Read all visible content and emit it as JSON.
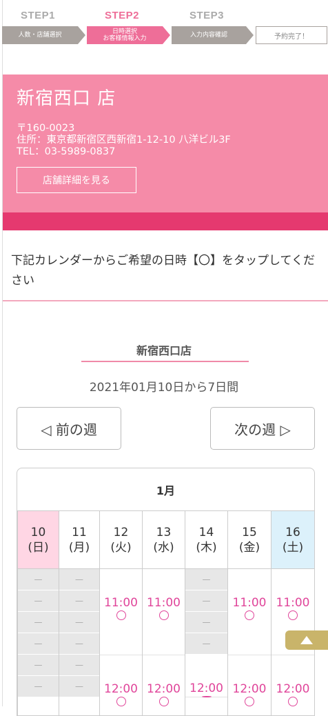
{
  "steps": [
    {
      "title": "STEP1",
      "label": "人数・店舗選択"
    },
    {
      "title": "STEP2",
      "label_line1": "日時選択",
      "label_line2": "お客様情報入力"
    },
    {
      "title": "STEP3",
      "label": "入力内容確認"
    },
    {
      "label": "予約完了！"
    }
  ],
  "store": {
    "name": "新宿西口 店",
    "address": "〒160-0023\n住所：東京都新宿区西新宿1-12-10 八洋ビル3F\nTEL：03-5989-0837",
    "detail_button": "店舗詳細を見る"
  },
  "instruction": "下記カレンダーからご希望の日時【〇】をタップしてください",
  "calendar": {
    "title": "新宿西口店",
    "range": "2021年01月10日から7日間",
    "prev_week": "◁ 前の週",
    "next_week": "次の週 ▷",
    "month": "1月",
    "days": [
      {
        "day": "10",
        "weekday": "(日)"
      },
      {
        "day": "11",
        "weekday": "(月)"
      },
      {
        "day": "12",
        "weekday": "(火)"
      },
      {
        "day": "13",
        "weekday": "(水)"
      },
      {
        "day": "14",
        "weekday": "(木)"
      },
      {
        "day": "15",
        "weekday": "(金)"
      },
      {
        "day": "16",
        "weekday": "(土)"
      }
    ],
    "unavailable": "—",
    "slot_11": "11:00",
    "slot_12": "12:00"
  },
  "colors": {
    "accent": "#ee6e98",
    "store_bg": "#f58ba8",
    "bar": "#e5396f",
    "time": "#e0459a"
  }
}
